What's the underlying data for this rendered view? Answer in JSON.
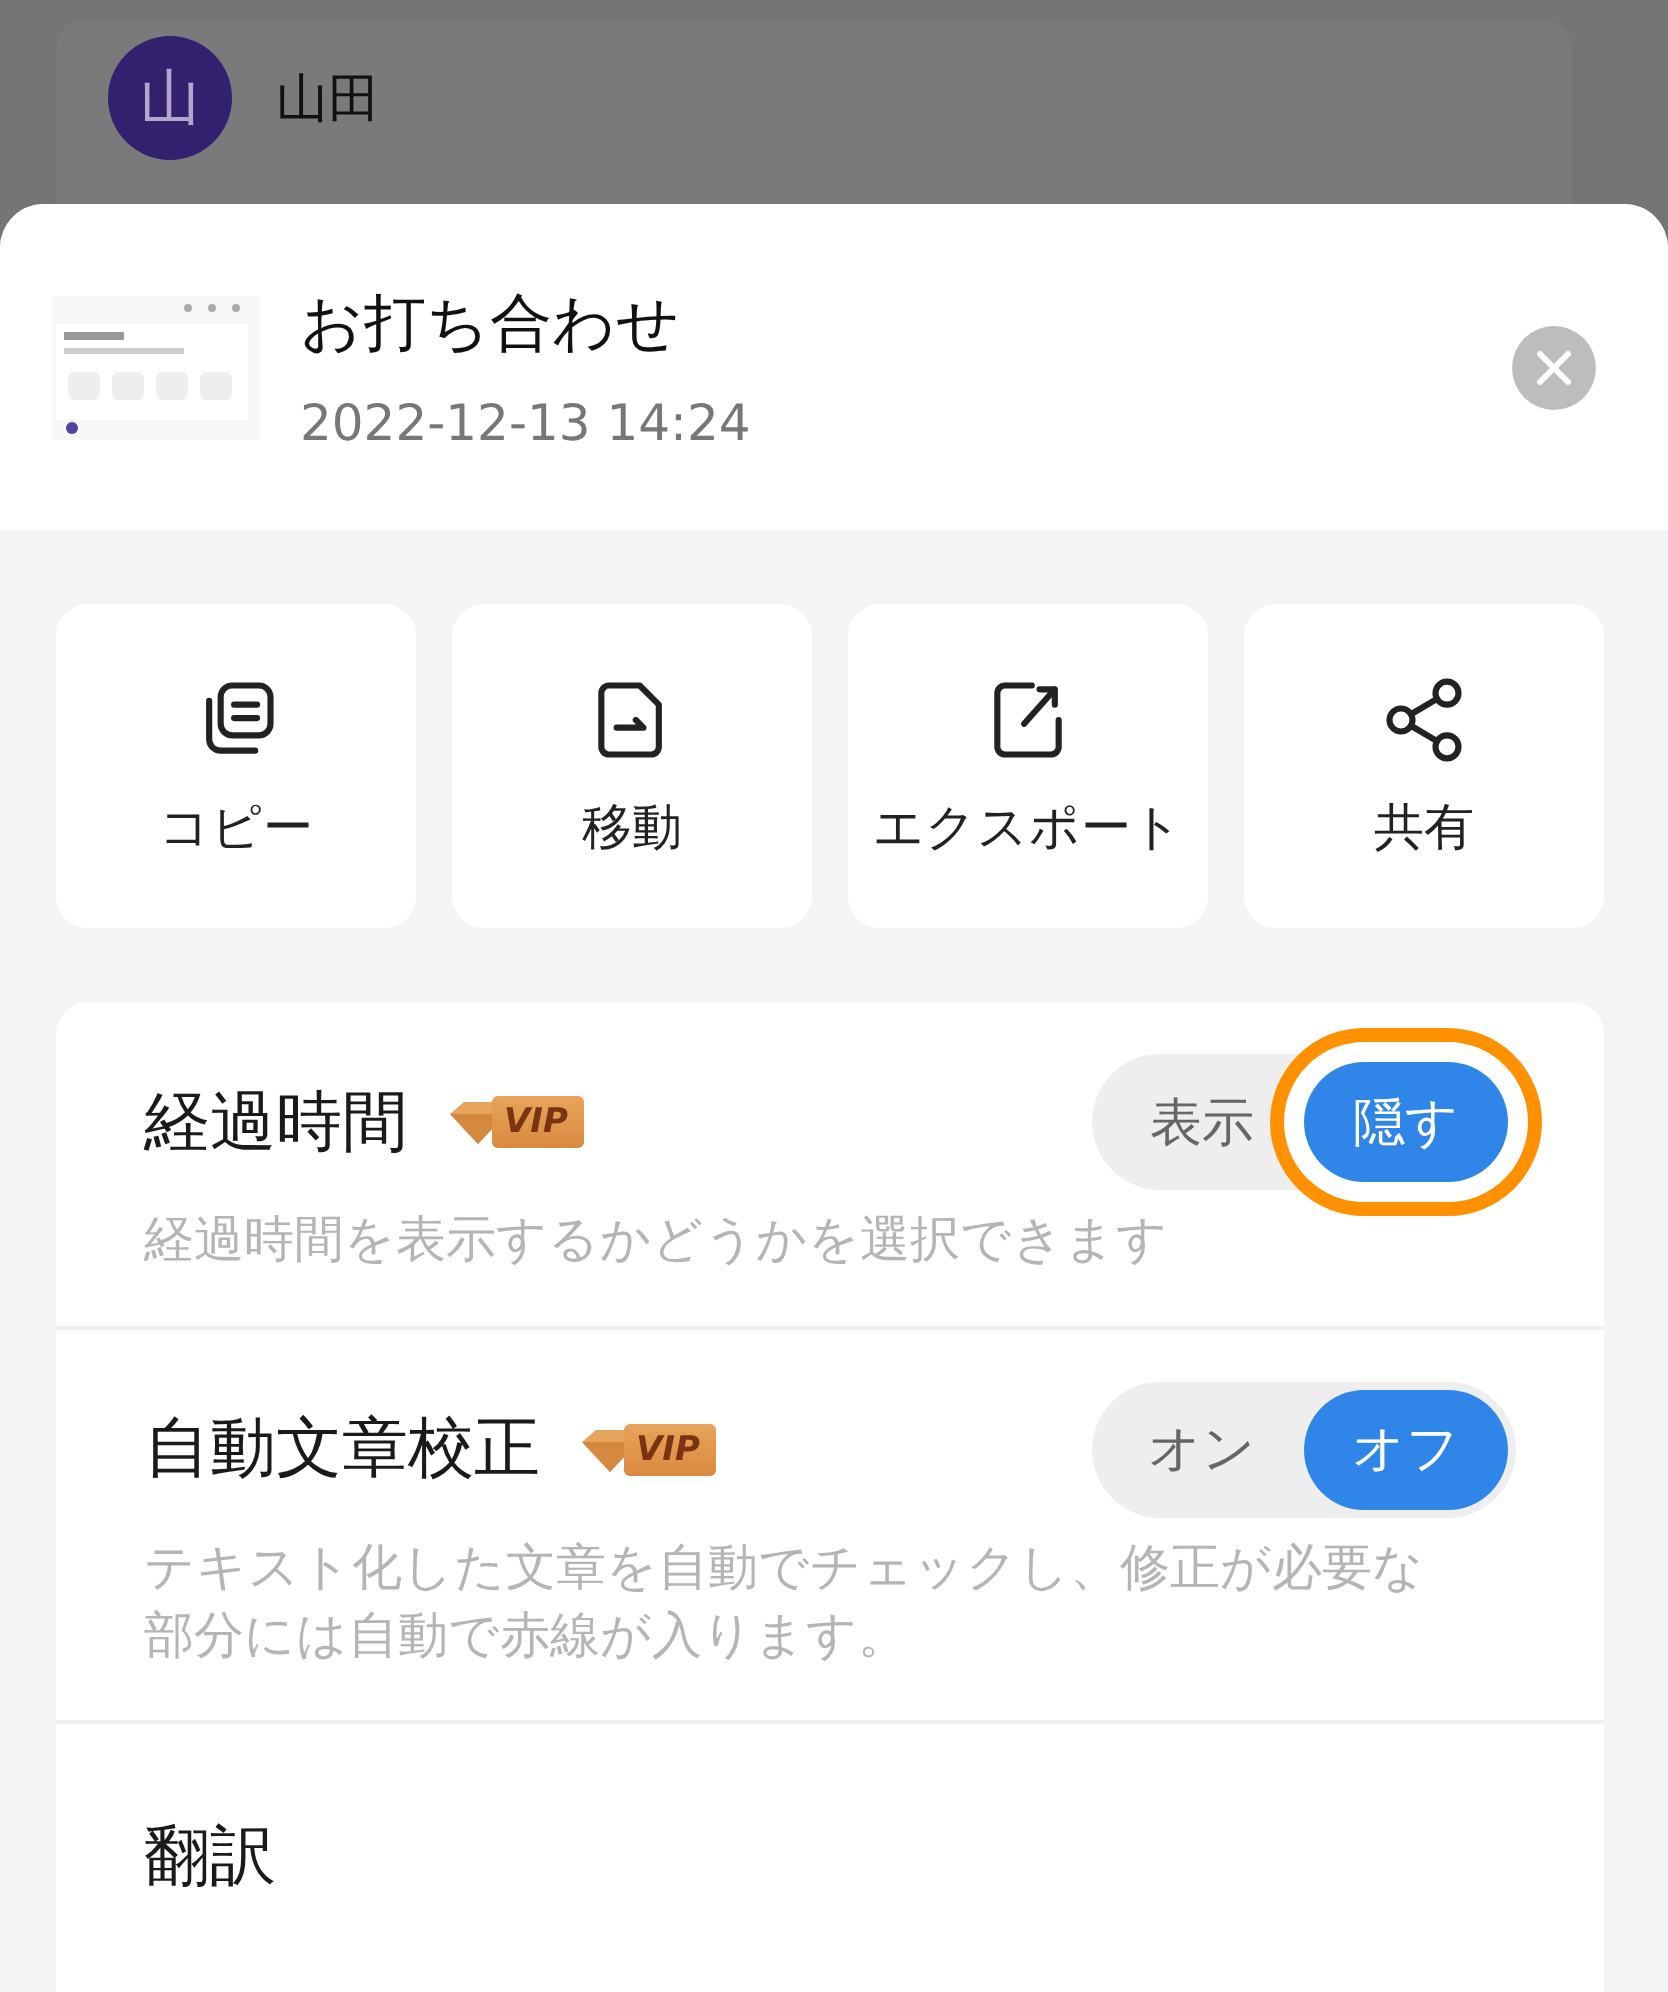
{
  "background": {
    "author": {
      "avatar": "山",
      "name": "山田"
    }
  },
  "sheet": {
    "title": "お打ち合わせ",
    "date": "2022-12-13 14:24",
    "actions": [
      {
        "label": "コピー",
        "kind": "copy"
      },
      {
        "label": "移動",
        "kind": "move"
      },
      {
        "label": "エクスポート",
        "kind": "export"
      },
      {
        "label": "共有",
        "kind": "share"
      }
    ],
    "settings": [
      {
        "kind": "toggle",
        "label": "経過時間",
        "badge": "VIP",
        "description": "経過時間を表示するかどうかを選択できます",
        "options": [
          {
            "label": "表示",
            "selected": false,
            "highlighted": false
          },
          {
            "label": "隠す",
            "selected": true,
            "highlighted": true
          }
        ]
      },
      {
        "kind": "toggle",
        "label": "自動文章校正",
        "badge": "VIP",
        "description": "テキスト化した文章を自動でチェックし、修正が必要な部分には自動で赤線が入ります。",
        "options": [
          {
            "label": "オン",
            "selected": false,
            "highlighted": false
          },
          {
            "label": "オフ",
            "selected": true,
            "highlighted": false
          }
        ]
      },
      {
        "kind": "link",
        "label": "翻訳"
      }
    ]
  }
}
